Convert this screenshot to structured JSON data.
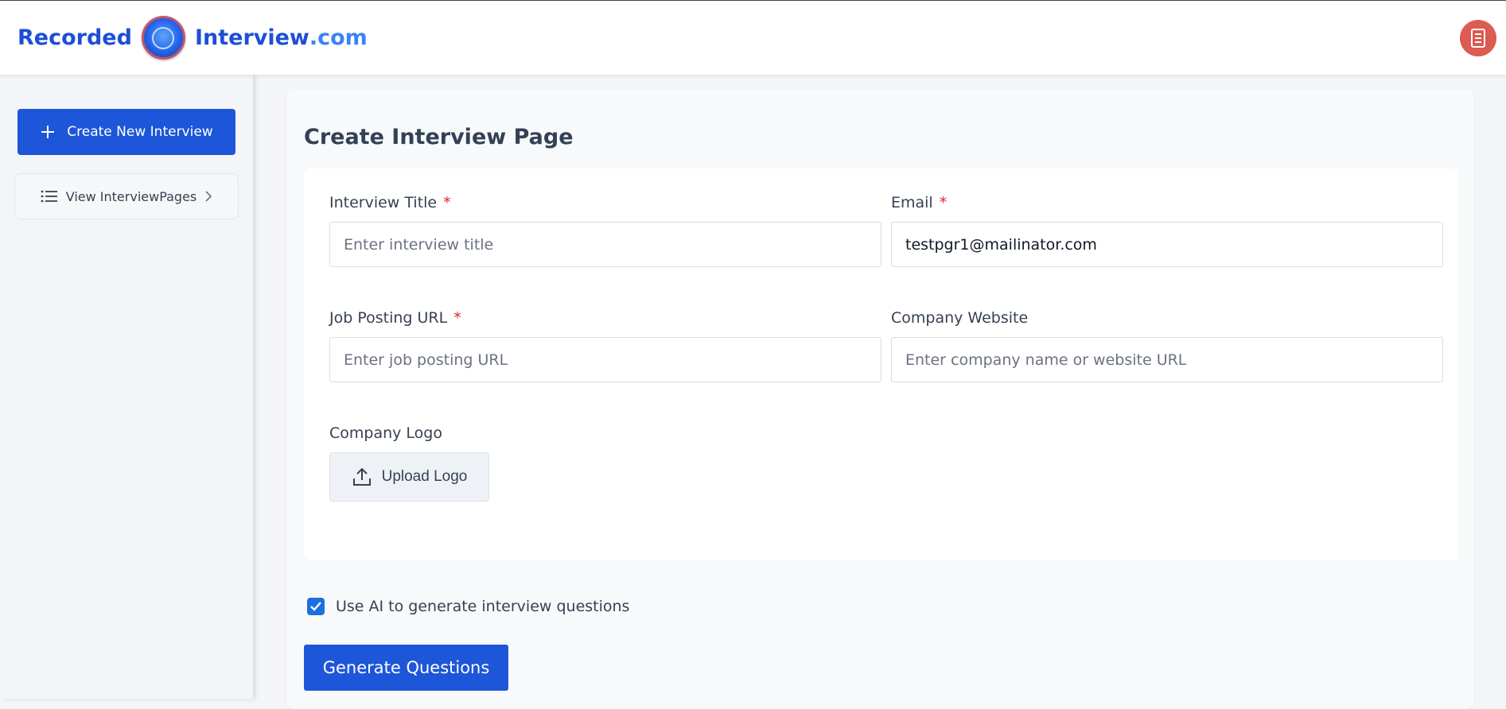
{
  "brand": {
    "word1": "Recorded",
    "word2": "Interview",
    "suffix": ".com"
  },
  "header": {
    "user_icon": "document-icon",
    "accent_color": "#dc5b52"
  },
  "sidebar": {
    "create_label": "Create New Interview",
    "view_label": "View InterviewPages"
  },
  "main": {
    "title": "Create Interview Page",
    "fields": {
      "interview_title": {
        "label": "Interview Title",
        "required_mark": "*",
        "placeholder": "Enter interview title",
        "value": ""
      },
      "email": {
        "label": "Email",
        "required_mark": "*",
        "placeholder": "",
        "value": "testpgr1@mailinator.com"
      },
      "job_posting_url": {
        "label": "Job Posting URL",
        "required_mark": "*",
        "placeholder": "Enter job posting URL",
        "value": ""
      },
      "company_website": {
        "label": "Company Website",
        "placeholder": "Enter company name or website URL",
        "value": ""
      },
      "company_logo": {
        "label": "Company Logo",
        "upload_label": "Upload Logo"
      }
    },
    "ai_checkbox": {
      "label": "Use AI to generate interview questions",
      "checked": true
    },
    "generate_label": "Generate Questions"
  },
  "colors": {
    "primary": "#1d56d8",
    "brand_blue": "#1d4ed8",
    "required": "#dc2626"
  }
}
